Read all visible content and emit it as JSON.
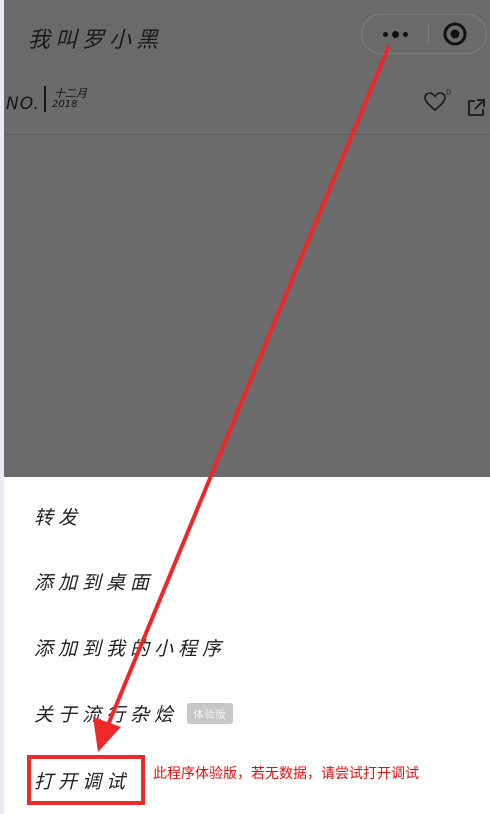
{
  "navbar": {
    "title": "我叫罗小黑"
  },
  "info_bar": {
    "no_label": "NO.",
    "month": "十二月",
    "year": "2018",
    "like_count": "0"
  },
  "menu": {
    "items": [
      {
        "label": "转发"
      },
      {
        "label": "添加到桌面"
      },
      {
        "label": "添加到我的小程序"
      },
      {
        "label": "关于流行杂烩",
        "badge": "体验版"
      },
      {
        "label": "打开调试"
      }
    ]
  },
  "annotation": {
    "text": "此程序体验版，若无数据，请尝试打开调试",
    "color": "#e60d0d"
  },
  "colors": {
    "overlay": "#6b6b6b",
    "highlight": "#ed2b2b"
  },
  "icons": {
    "more": "more-dots-icon",
    "close": "target-close-icon",
    "like": "heart-icon",
    "share": "share-icon"
  }
}
